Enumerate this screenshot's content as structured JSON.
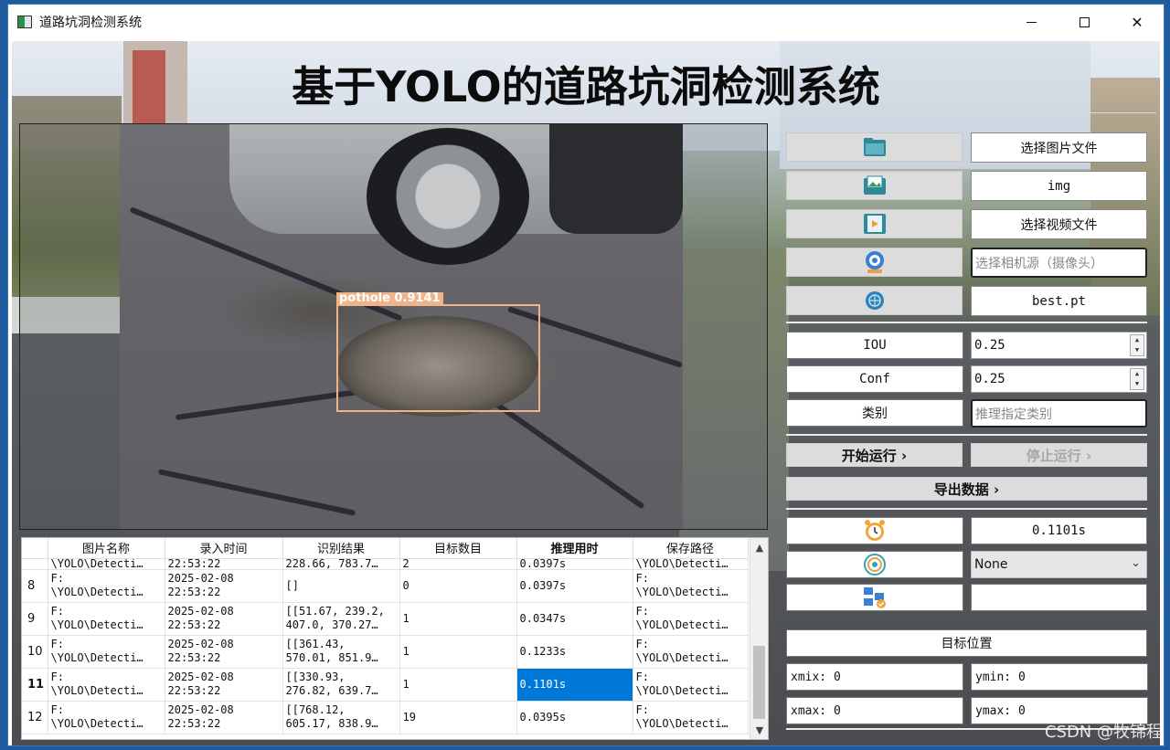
{
  "window": {
    "title": "道路坑洞检测系统",
    "minimize": "—",
    "maximize": "☐",
    "close": "✕"
  },
  "header": {
    "title": "基于YOLO的道路坑洞检测系统"
  },
  "detection": {
    "label": "pothole  0.9141"
  },
  "controls": {
    "select_image": "选择图片文件",
    "img_folder": "img",
    "select_video": "选择视频文件",
    "camera_placeholder": "选择相机源（摄像头）",
    "model": "best.pt",
    "iou_label": "IOU",
    "iou_value": "0.25",
    "conf_label": "Conf",
    "conf_value": "0.25",
    "class_label": "类别",
    "class_placeholder": "推理指定类别",
    "start": "开始运行 ›",
    "stop": "停止运行 ›",
    "export": "导出数据 ›"
  },
  "info": {
    "time_value": "0.1101s",
    "target_select": "None",
    "target_position_title": "目标位置",
    "xmin": "xmix: 0",
    "ymin": "ymin: 0",
    "xmax": "xmax: 0",
    "ymax": "ymax: 0"
  },
  "icons": {
    "folder": "folder-icon",
    "image_folder": "image-folder-icon",
    "video": "video-icon",
    "camera": "camera-icon",
    "model": "model-icon",
    "clock": "alarm-clock-icon",
    "target": "target-icon",
    "position": "position-icon"
  },
  "table": {
    "headers": [
      "图片名称",
      "录入时间",
      "识别结果",
      "目标数目",
      "推理用时",
      "保存路径"
    ],
    "partial_row": {
      "name": "\\YOLO\\Detecti…",
      "time": "22:53:22",
      "result": "228.66, 783.7…",
      "count": "2",
      "infer": "0.0397s",
      "path": "\\YOLO\\Detecti…"
    },
    "rows": [
      {
        "num": "8",
        "name1": "F:",
        "name2": "\\YOLO\\Detecti…",
        "time1": "2025-02-08",
        "time2": "22:53:22",
        "res1": "[]",
        "res2": "",
        "count": "0",
        "infer": "0.0397s",
        "path1": "F:",
        "path2": "\\YOLO\\Detecti…"
      },
      {
        "num": "9",
        "name1": "F:",
        "name2": "\\YOLO\\Detecti…",
        "time1": "2025-02-08",
        "time2": "22:53:22",
        "res1": "[[51.67, 239.2,",
        "res2": "407.0, 370.27…",
        "count": "1",
        "infer": "0.0347s",
        "path1": "F:",
        "path2": "\\YOLO\\Detecti…"
      },
      {
        "num": "10",
        "name1": "F:",
        "name2": "\\YOLO\\Detecti…",
        "time1": "2025-02-08",
        "time2": "22:53:22",
        "res1": "[[361.43,",
        "res2": "570.01, 851.9…",
        "count": "1",
        "infer": "0.1233s",
        "path1": "F:",
        "path2": "\\YOLO\\Detecti…"
      },
      {
        "num": "11",
        "name1": "F:",
        "name2": "\\YOLO\\Detecti…",
        "time1": "2025-02-08",
        "time2": "22:53:22",
        "res1": "[[330.93,",
        "res2": "276.82, 639.7…",
        "count": "1",
        "infer": "0.1101s",
        "path1": "F:",
        "path2": "\\YOLO\\Detecti…"
      },
      {
        "num": "12",
        "name1": "F:",
        "name2": "\\YOLO\\Detecti…",
        "time1": "2025-02-08",
        "time2": "22:53:22",
        "res1": "[[768.12,",
        "res2": "605.17, 838.9…",
        "count": "19",
        "infer": "0.0395s",
        "path1": "F:",
        "path2": "\\YOLO\\Detecti…"
      }
    ]
  },
  "watermark": "CSDN @牧锦程",
  "colors": {
    "selection": "#0078d7",
    "box": "#f0b48a",
    "button_gray": "#dcdcdc"
  }
}
